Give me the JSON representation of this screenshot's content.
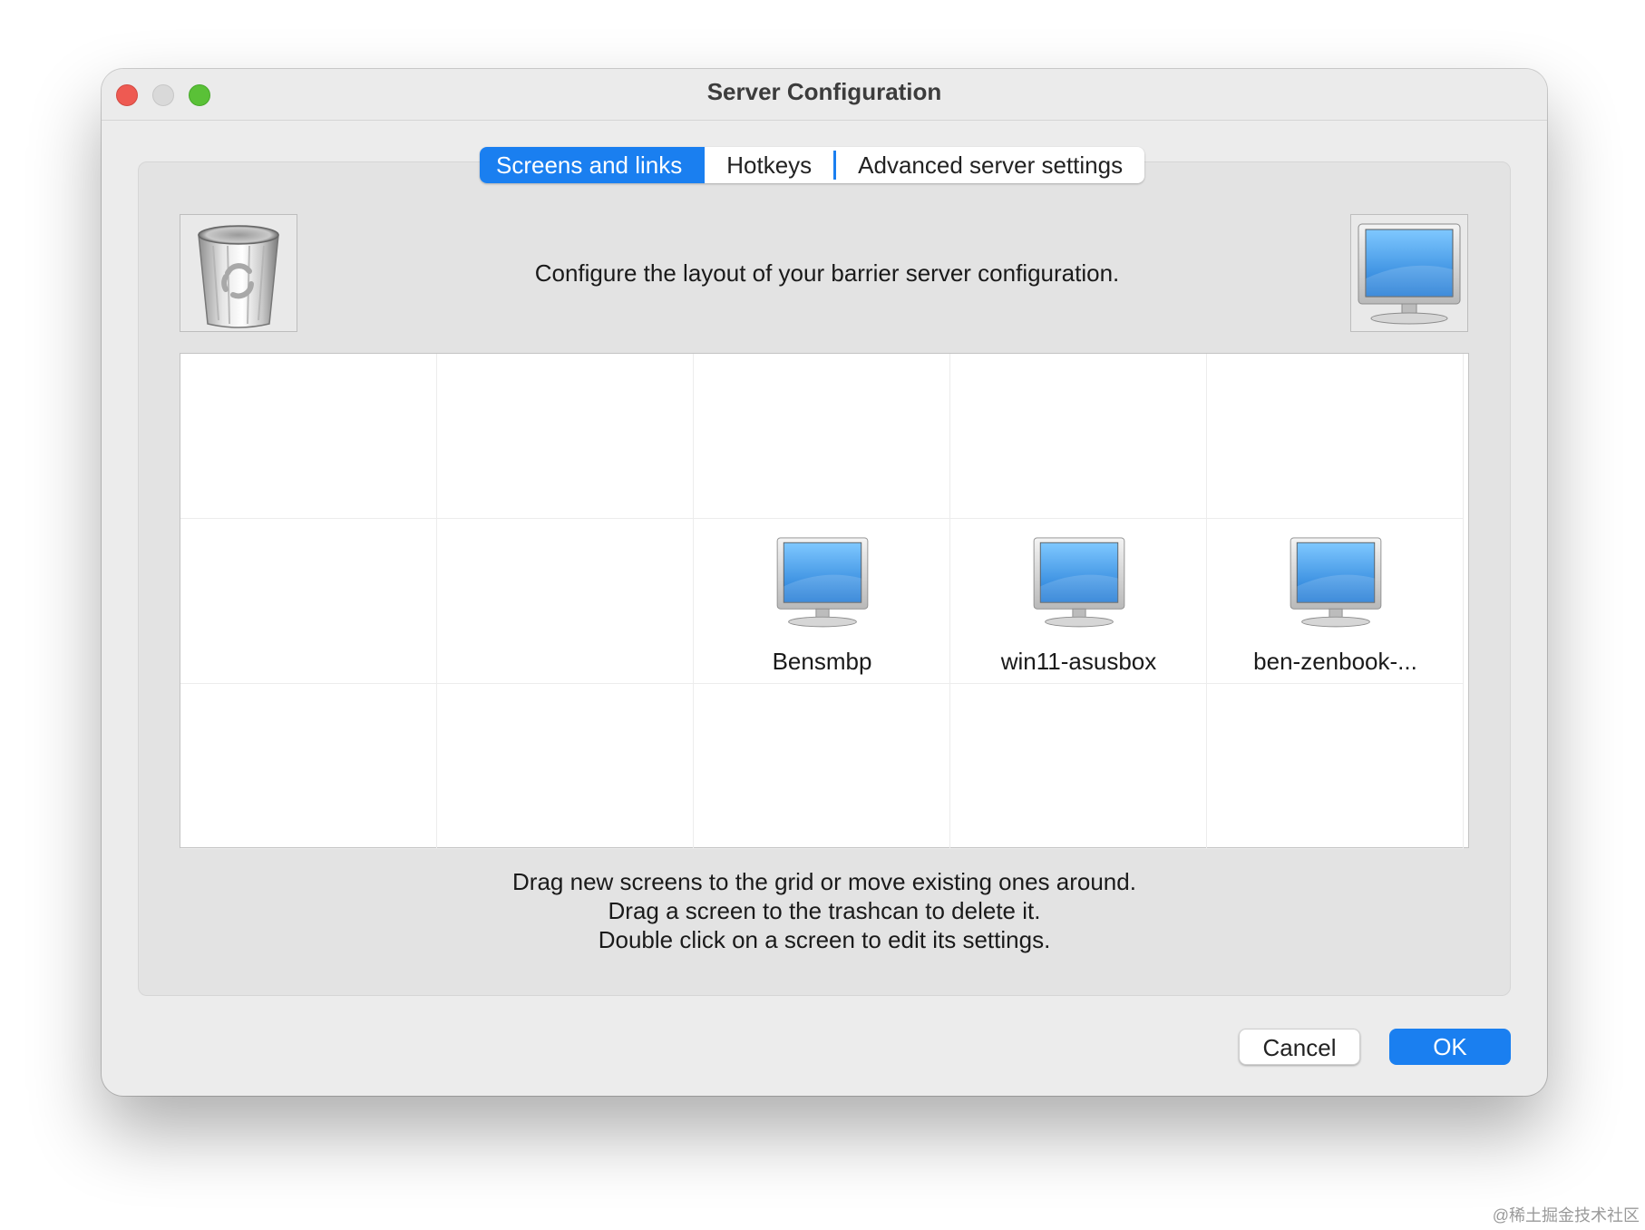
{
  "window": {
    "title": "Server Configuration"
  },
  "tabs": [
    {
      "label": "Screens and links",
      "active": true
    },
    {
      "label": "Hotkeys",
      "active": false
    },
    {
      "label": "Advanced server settings",
      "active": false
    }
  ],
  "configure_text": "Configure the layout of your barrier server configuration.",
  "grid": {
    "rows": 3,
    "columns": 5,
    "screens": [
      {
        "name": "Bensmbp",
        "row": 1,
        "col": 2
      },
      {
        "name": "win11-asusbox",
        "row": 1,
        "col": 3
      },
      {
        "name": "ben-zenbook-...",
        "row": 1,
        "col": 4
      }
    ]
  },
  "help_lines": [
    "Drag new screens to the grid or move existing ones around.",
    "Drag a screen to the trashcan to delete it.",
    "Double click on a screen to edit its settings."
  ],
  "buttons": {
    "cancel": "Cancel",
    "ok": "OK"
  },
  "watermark": "@稀土掘金技术社区",
  "icons": {
    "trash": "trash-can-icon",
    "new_screen": "monitor-icon"
  },
  "colors": {
    "accent": "#1a7ff0",
    "close": "#ee5a52",
    "maximize": "#5ac137"
  }
}
